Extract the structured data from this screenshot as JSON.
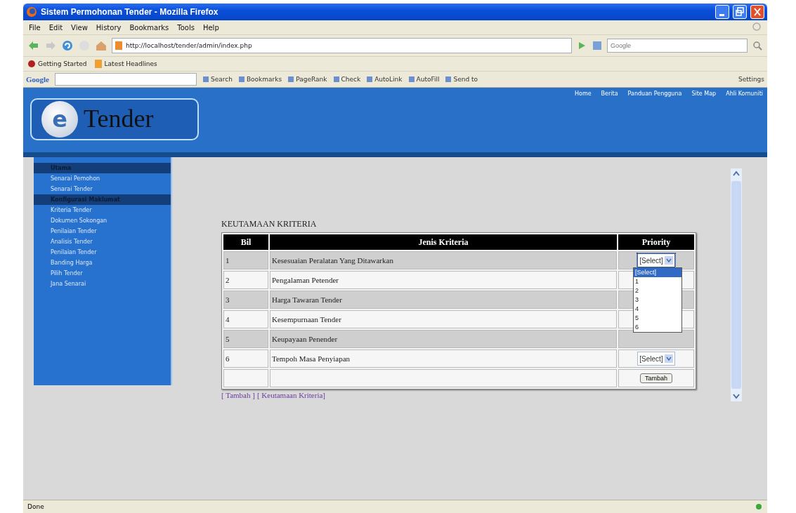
{
  "window": {
    "title": "Sistem Permohonan Tender - Mozilla Firefox"
  },
  "menu": [
    "File",
    "Edit",
    "View",
    "History",
    "Bookmarks",
    "Tools",
    "Help"
  ],
  "address_bar": {
    "value": "http://localhost/tender/admin/index.php"
  },
  "search_field": {
    "placeholder": "Google"
  },
  "bookmarks": [
    "Getting Started",
    "Latest Headlines"
  ],
  "google_toolbar": {
    "label": "Google",
    "items": [
      "Search",
      "Bookmarks",
      "PageRank",
      "Check",
      "AutoLink",
      "AutoFill",
      "Send to"
    ],
    "settings": "Settings"
  },
  "site": {
    "logo_mark": "e",
    "logo_text": "Tender",
    "nav": [
      "Home",
      "Berita",
      "Panduan Pengguna",
      "Site Map",
      "Ahli Komuniti"
    ]
  },
  "sidebar": {
    "items": [
      {
        "label": "Utama",
        "kind": "header"
      },
      {
        "label": "Senarai Pemohon",
        "kind": "link"
      },
      {
        "label": "Senarai Tender",
        "kind": "link"
      },
      {
        "label": "Konfigurasi Maklumat",
        "kind": "header"
      },
      {
        "label": "Kriteria Tender",
        "kind": "link"
      },
      {
        "label": "Dokumen Sokongan",
        "kind": "link"
      },
      {
        "label": "Penilaian Tender",
        "kind": "link"
      },
      {
        "label": "Analisis Tender",
        "kind": "link"
      },
      {
        "label": "Penilaian Tender",
        "kind": "link"
      },
      {
        "label": "Banding Harga",
        "kind": "link"
      },
      {
        "label": "Pilih Tender",
        "kind": "link"
      },
      {
        "label": "Jana Senarai",
        "kind": "link"
      }
    ]
  },
  "section_title": "KEUTAMAAN KRITERIA",
  "table": {
    "columns": [
      "Bil",
      "Jenis Kriteria",
      "Priority"
    ],
    "rows": [
      {
        "bil": "1",
        "criteria": "Kesesuaian Peralatan Yang Ditawarkan",
        "priority": "[Select]",
        "expanded": true,
        "options": [
          {
            "label": "[Select]",
            "selected": true
          },
          {
            "label": "1",
            "selected": false
          },
          {
            "label": "2",
            "selected": false
          },
          {
            "label": "3",
            "selected": false
          },
          {
            "label": "4",
            "selected": false
          },
          {
            "label": "5",
            "selected": false
          },
          {
            "label": "6",
            "selected": false
          }
        ]
      },
      {
        "bil": "2",
        "criteria": "Pengalaman Petender"
      },
      {
        "bil": "3",
        "criteria": "Harga Tawaran Tender"
      },
      {
        "bil": "4",
        "criteria": "Kesempurnaan Tender"
      },
      {
        "bil": "5",
        "criteria": "Keupayaan Penender"
      },
      {
        "bil": "6",
        "criteria": "Tempoh Masa Penyiapan",
        "priority": "[Select]",
        "expanded": false
      }
    ],
    "footer_button": "Tambah"
  },
  "links": [
    "[ Tambah ]",
    "[ Keutamaan Kriteria]"
  ],
  "status_bar": {
    "text": "Done"
  }
}
